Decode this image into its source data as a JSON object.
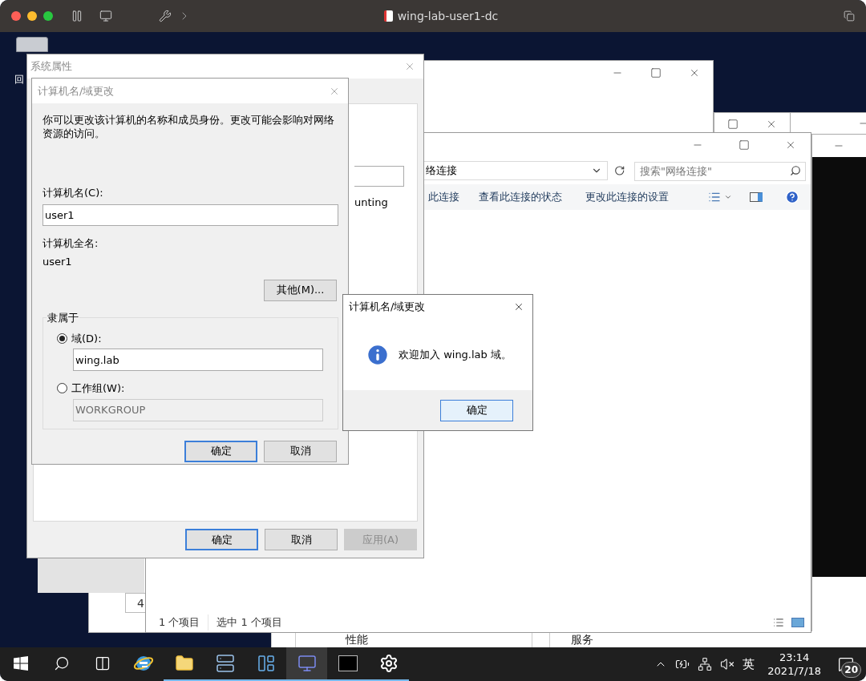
{
  "host_window": {
    "title": "wing-lab-user1-dc"
  },
  "desktop_icon": {
    "label": "回"
  },
  "back_list": {
    "cells": [
      "性能",
      "服务"
    ]
  },
  "back_tab": {
    "label": "4"
  },
  "explorer": {
    "address": "络连接",
    "search": {
      "placeholder": "搜索\"网络连接\""
    },
    "commands": [
      "此连接",
      "查看此连接的状态",
      "更改此连接的设置"
    ],
    "status": [
      "1 个项目",
      "选中 1 个项目"
    ]
  },
  "system_properties": {
    "title": "系统属性",
    "partial_text": "unting",
    "buttons": [
      {
        "label": "确定",
        "default": true,
        "disabled": false
      },
      {
        "label": "取消",
        "default": false,
        "disabled": false
      },
      {
        "label": "应用(A)",
        "default": false,
        "disabled": true
      }
    ]
  },
  "name_dialog": {
    "title": "计算机名/域更改",
    "intro": "你可以更改该计算机的名称和成员身份。更改可能会影响对网络资源的访问。",
    "name_label": "计算机名(C):",
    "name_value": "user1",
    "full_name_label": "计算机全名:",
    "full_name": "user1",
    "more_button": "其他(M)...",
    "member_of": "隶属于",
    "options": [
      {
        "label": "域(D):",
        "selected": true,
        "value": "wing.lab"
      },
      {
        "label": "工作组(W):",
        "selected": false,
        "value": "WORKGROUP"
      }
    ],
    "buttons": [
      {
        "label": "确定",
        "default": true
      },
      {
        "label": "取消",
        "default": false
      }
    ]
  },
  "message_box": {
    "title": "计算机名/域更改",
    "message": "欢迎加入 wing.lab 域。",
    "button": "确定"
  },
  "taskbar": {
    "apps": [
      {
        "kind": "start",
        "selected": false,
        "running": false
      },
      {
        "kind": "search",
        "selected": false,
        "running": false
      },
      {
        "kind": "taskview",
        "selected": false,
        "running": false
      },
      {
        "kind": "browser",
        "selected": false,
        "running": false
      },
      {
        "kind": "folder",
        "selected": false,
        "running": true
      },
      {
        "kind": "server",
        "selected": false,
        "running": true
      },
      {
        "kind": "panel",
        "selected": false,
        "running": true
      },
      {
        "kind": "computer",
        "selected": true,
        "running": true
      },
      {
        "kind": "terminal",
        "selected": false,
        "running": true
      },
      {
        "kind": "settings",
        "selected": false,
        "running": true
      }
    ],
    "tray": {
      "ime": "英",
      "time": "23:14",
      "date": "2021/7/18",
      "notifications": "20"
    }
  }
}
